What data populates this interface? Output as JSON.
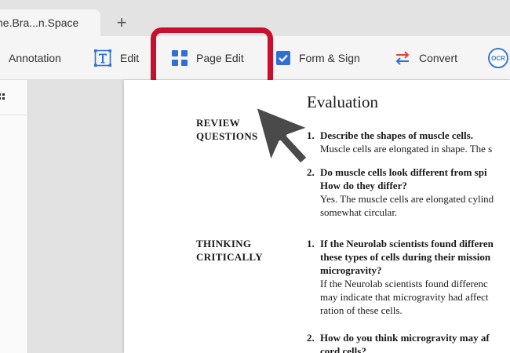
{
  "tab": {
    "title": "he.Bra...n.Space",
    "new_tab_symbol": "+"
  },
  "toolbar": {
    "annotation": "Annotation",
    "edit": "Edit",
    "page_edit": "Page Edit",
    "form_sign": "Form & Sign",
    "convert": "Convert",
    "ocr": "OCR",
    "accent_color": "#2f6fd6",
    "highlight_color": "#c8102e"
  },
  "icons": {
    "edit": "text-box-icon",
    "page_edit": "grid-icon",
    "form_sign": "checkbox-icon",
    "convert": "convert-arrows-icon",
    "ocr": "ocr-icon",
    "left_panel": "thumbnail-grid-icon",
    "pointer": "mouse-pointer-icon"
  },
  "document": {
    "heading": "Evaluation",
    "sections": [
      {
        "title_lines": [
          "REVIEW",
          "QUESTIONS"
        ],
        "questions": [
          {
            "number": "1.",
            "question_lines": [
              "Describe the shapes of muscle cells."
            ],
            "answer_lines": [
              "Muscle cells are elongated in shape. The s"
            ]
          },
          {
            "number": "2.",
            "question_lines": [
              "Do muscle cells look different from spi",
              "How do they differ?"
            ],
            "answer_lines": [
              "Yes. The muscle cells are elongated cylind",
              "somewhat circular."
            ]
          }
        ]
      },
      {
        "title_lines": [
          "THINKING",
          "CRITICALLY"
        ],
        "questions": [
          {
            "number": "1.",
            "question_lines": [
              "If the Neurolab scientists found differen",
              "these types of cells during their mission",
              "microgravity?"
            ],
            "answer_lines": [
              "If the Neurolab scientists found differenc",
              "may indicate that microgravity had affect",
              "ration of these cells."
            ]
          },
          {
            "number": "2.",
            "question_lines": [
              "How do you think microgravity may af",
              "cord cells?"
            ],
            "answer_lines": []
          }
        ]
      }
    ]
  }
}
